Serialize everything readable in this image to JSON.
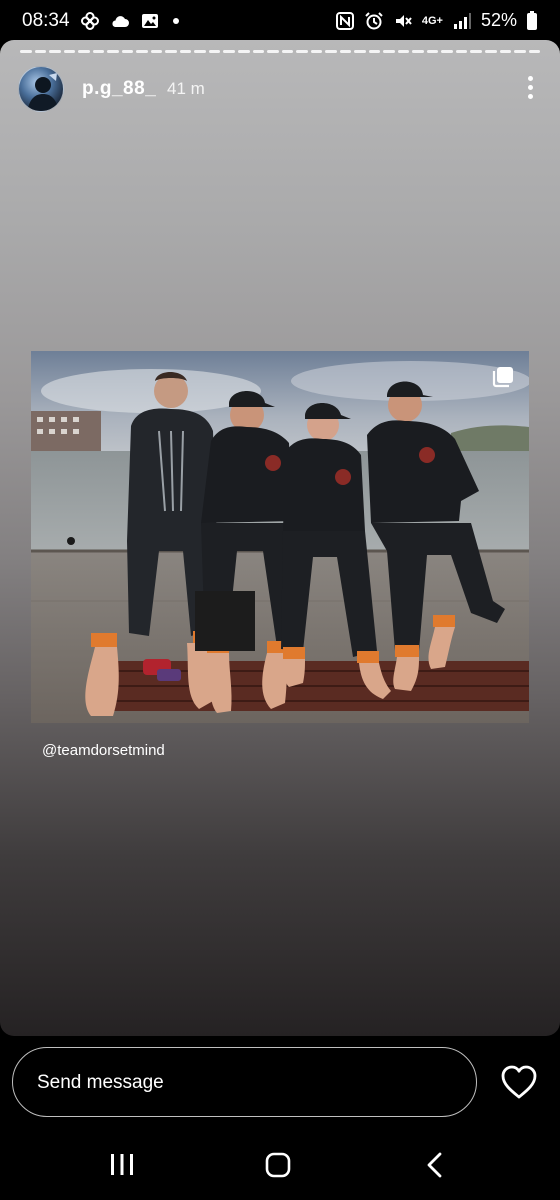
{
  "status_bar": {
    "time": "08:34",
    "network": "4G+",
    "battery": "52%"
  },
  "story": {
    "username": "p.g_88_",
    "time_ago": "41 m",
    "caption": "@teamdorsetmind",
    "more_icon": "more-vertical-icon",
    "multi_image_icon": "copy-icon"
  },
  "reply": {
    "placeholder": "Send message",
    "like_icon": "heart-icon"
  },
  "nav": {
    "recents_icon": "recents-icon",
    "home_icon": "home-icon",
    "back_icon": "back-icon"
  }
}
